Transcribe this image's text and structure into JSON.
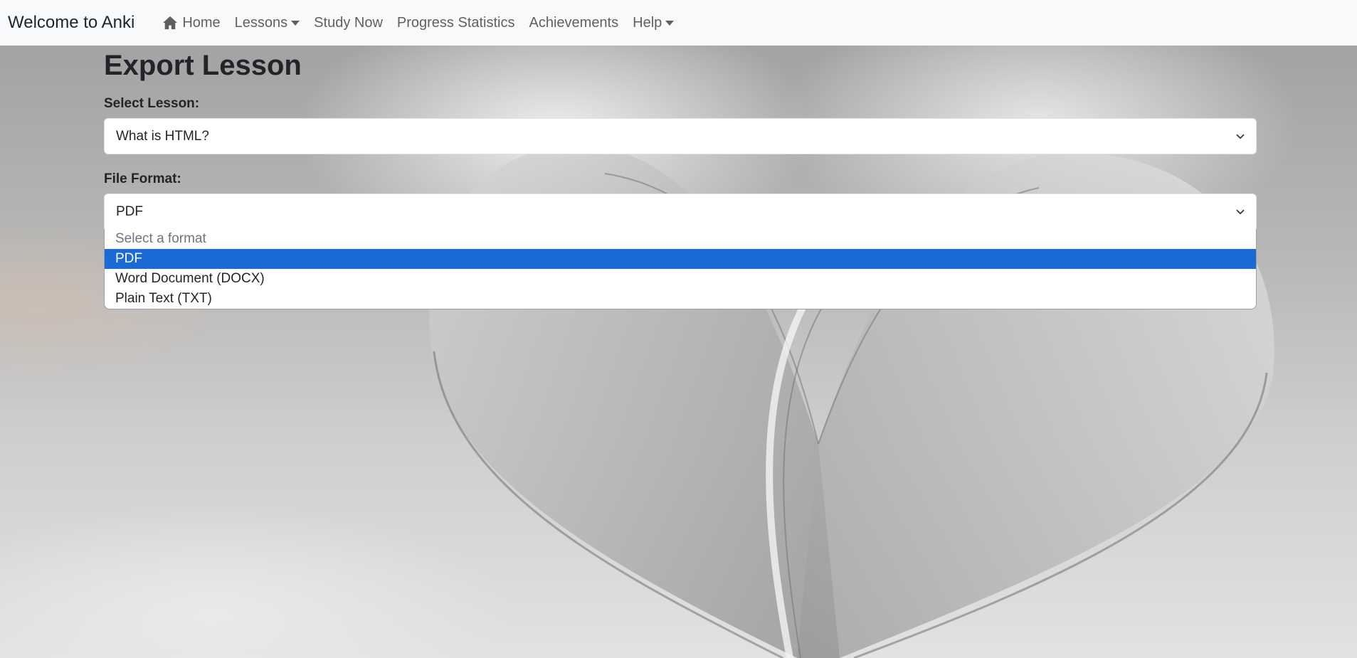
{
  "navbar": {
    "brand": "Welcome to Anki",
    "items": [
      {
        "label": "Home",
        "icon": "home-icon"
      },
      {
        "label": "Lessons",
        "dropdown": true
      },
      {
        "label": "Study Now"
      },
      {
        "label": "Progress Statistics"
      },
      {
        "label": "Achievements"
      },
      {
        "label": "Help",
        "dropdown": true
      }
    ]
  },
  "page": {
    "title": "Export Lesson",
    "lesson_label": "Select Lesson:",
    "lesson_value": "What is HTML?",
    "format_label": "File Format:",
    "format_value": "PDF",
    "format_options": [
      {
        "label": "Select a format",
        "placeholder": true
      },
      {
        "label": "PDF",
        "selected": true
      },
      {
        "label": "Word Document (DOCX)"
      },
      {
        "label": "Plain Text (TXT)"
      }
    ]
  },
  "colors": {
    "navbar_bg": "#f8f9fa",
    "selected_option": "#1a6ad6"
  }
}
